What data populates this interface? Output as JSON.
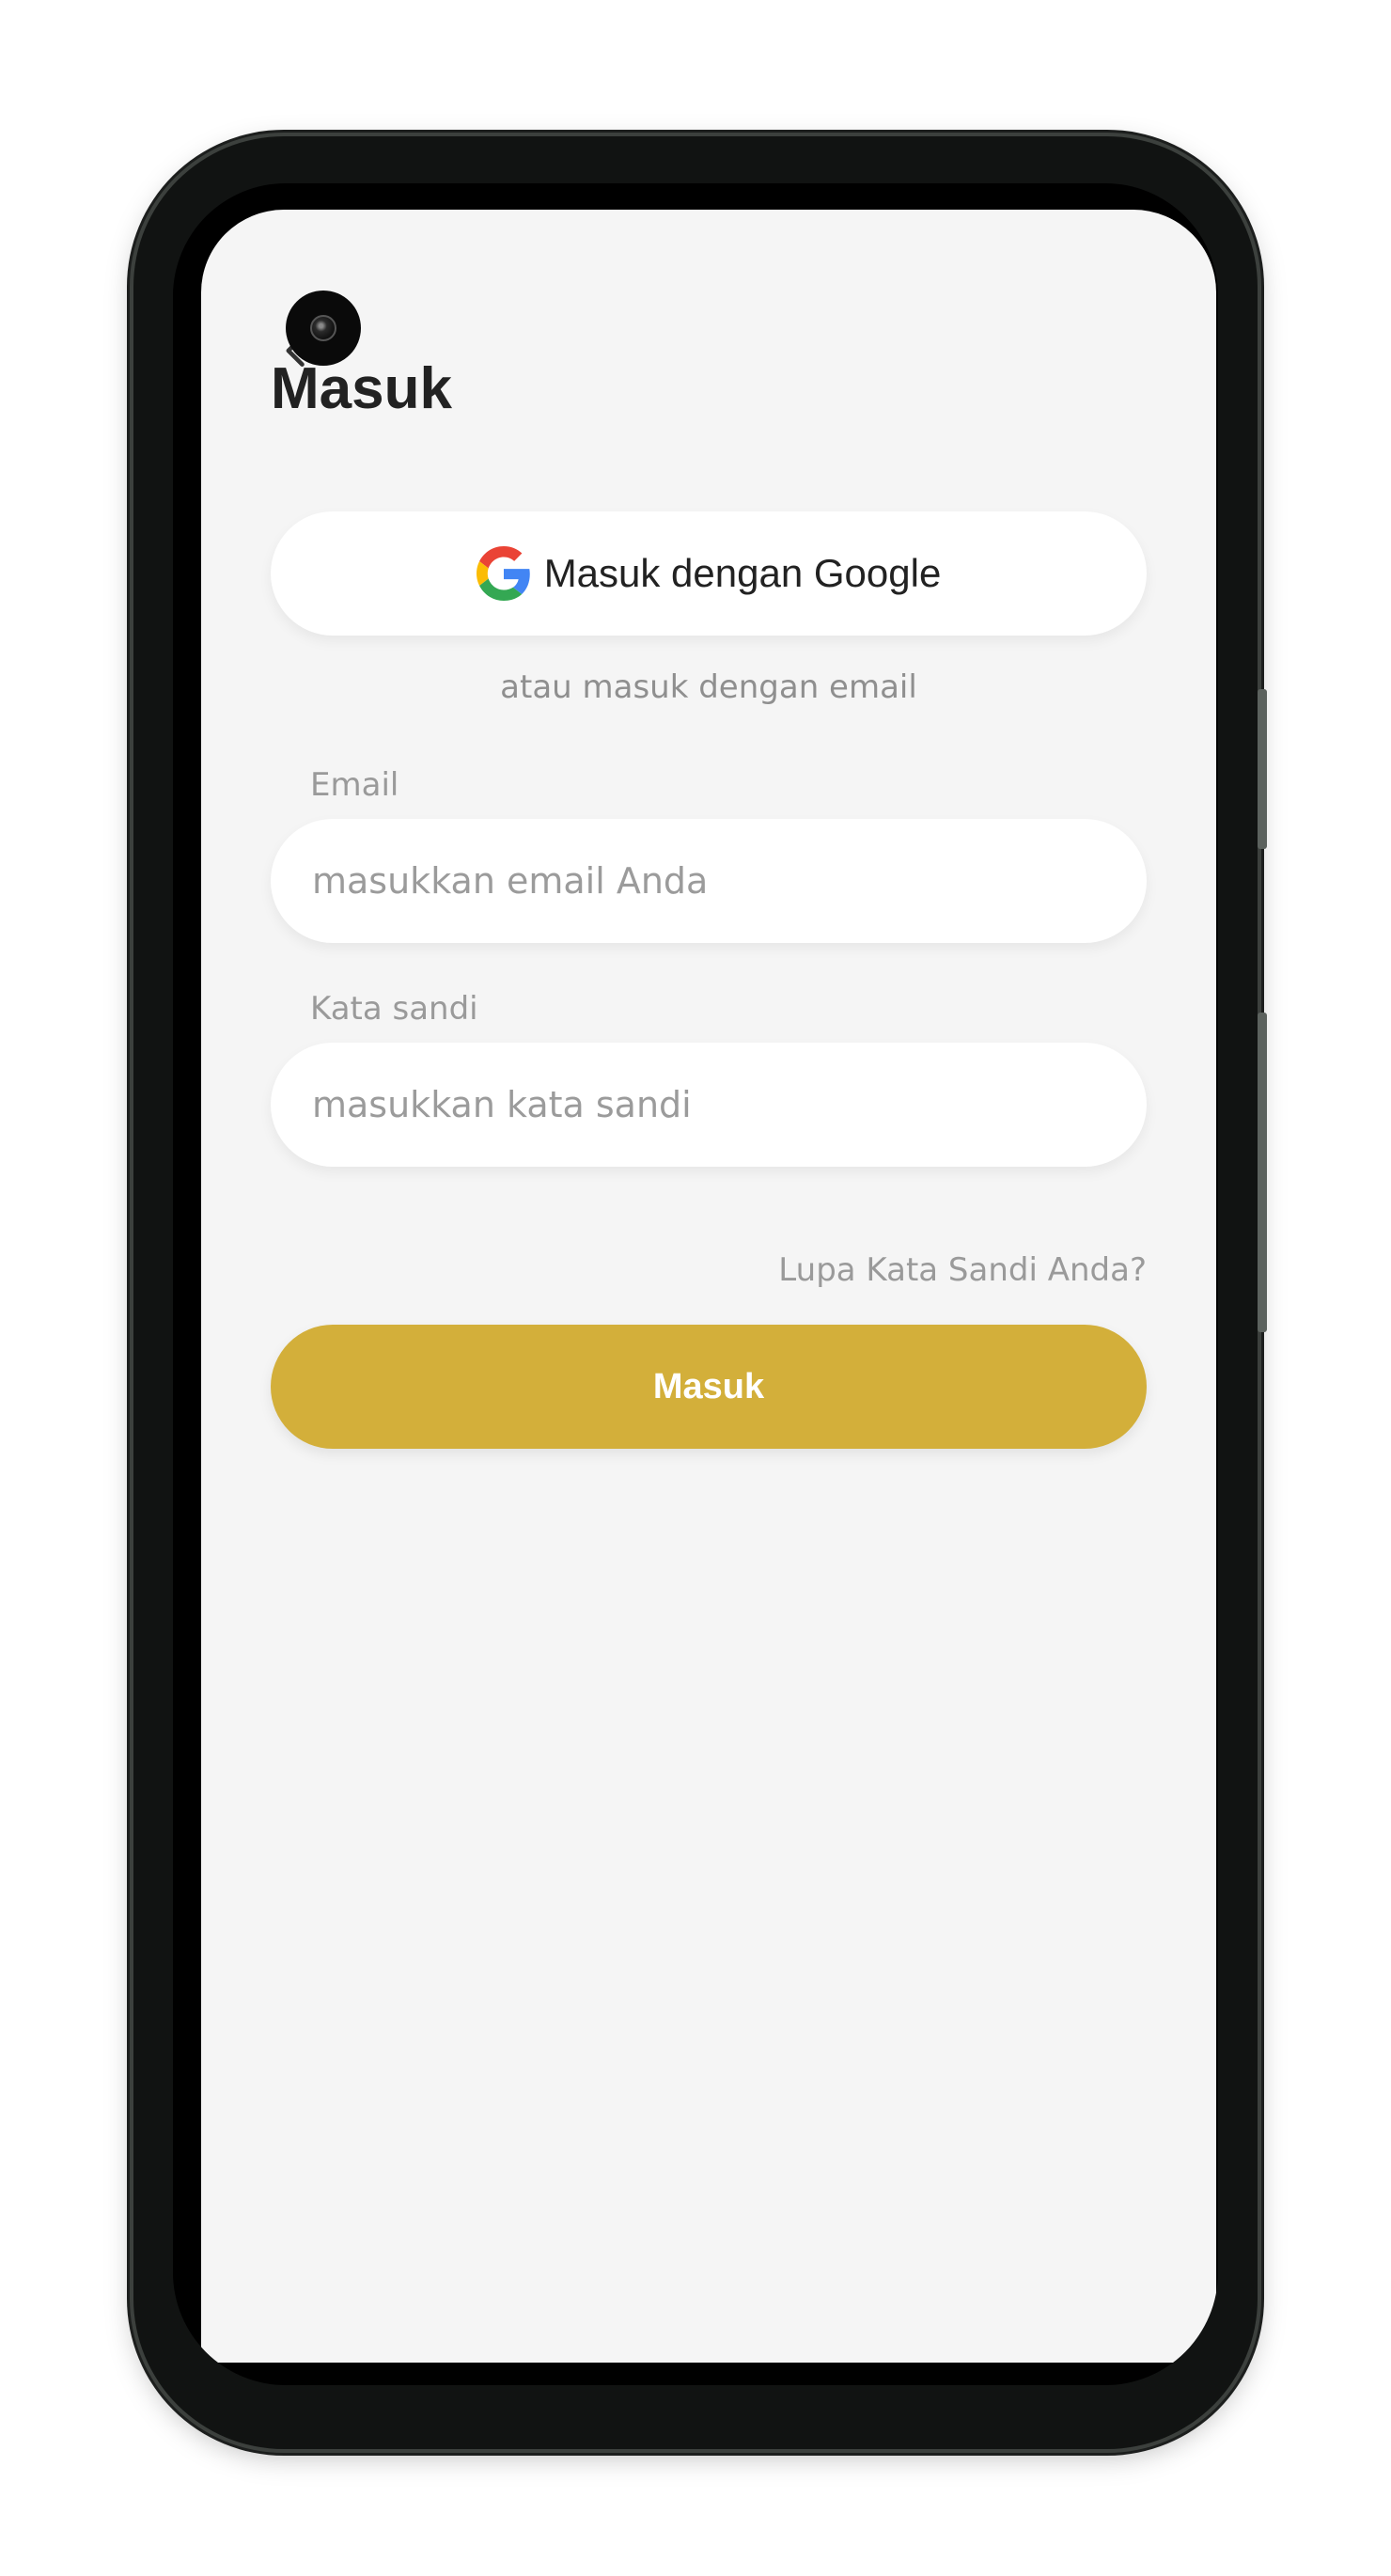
{
  "page": {
    "title": "Masuk"
  },
  "google": {
    "label": "Masuk dengan Google"
  },
  "divider": {
    "text": "atau masuk dengan email"
  },
  "email": {
    "label": "Email",
    "placeholder": "masukkan email Anda",
    "value": ""
  },
  "password": {
    "label": "Kata sandi",
    "placeholder": "masukkan kata sandi",
    "value": ""
  },
  "forgot": {
    "label": "Lupa Kata Sandi Anda?"
  },
  "submit": {
    "label": "Masuk"
  },
  "colors": {
    "accent": "#d3af3a",
    "background": "#f5f5f5",
    "surface": "#ffffff",
    "title_text": "#222222",
    "muted_text": "#9a9a9a"
  },
  "icons": {
    "back": "back-arrow-icon",
    "google": "google-logo-icon",
    "camera": "front-camera"
  }
}
